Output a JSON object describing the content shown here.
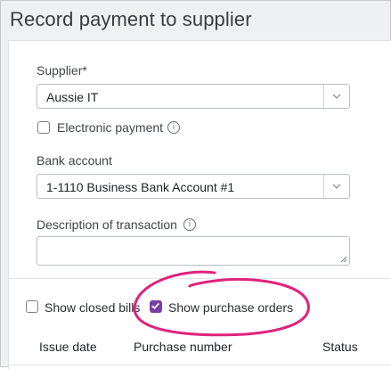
{
  "dialog": {
    "title": "Record payment to supplier"
  },
  "form": {
    "supplier": {
      "label": "Supplier",
      "required_marker": "*",
      "value": "Aussie IT"
    },
    "electronic_payment": {
      "label": "Electronic payment",
      "checked": false
    },
    "bank_account": {
      "label": "Bank account",
      "value": "1-1110 Business Bank Account #1"
    },
    "description": {
      "label": "Description of transaction",
      "value": ""
    }
  },
  "filters": {
    "show_closed_bills": {
      "label": "Show closed bills",
      "checked": false
    },
    "show_purchase_orders": {
      "label": "Show purchase orders",
      "checked": true
    }
  },
  "table": {
    "columns": [
      "Issue date",
      "Purchase number",
      "Status"
    ]
  },
  "colors": {
    "accent": "#7b3fa3",
    "highlight_circle": "#e0237d"
  },
  "icons": {
    "info": "info-circle-icon",
    "dropdown": "chevron-down-icon",
    "check": "checkmark-icon",
    "resize": "resize-grip-icon"
  }
}
